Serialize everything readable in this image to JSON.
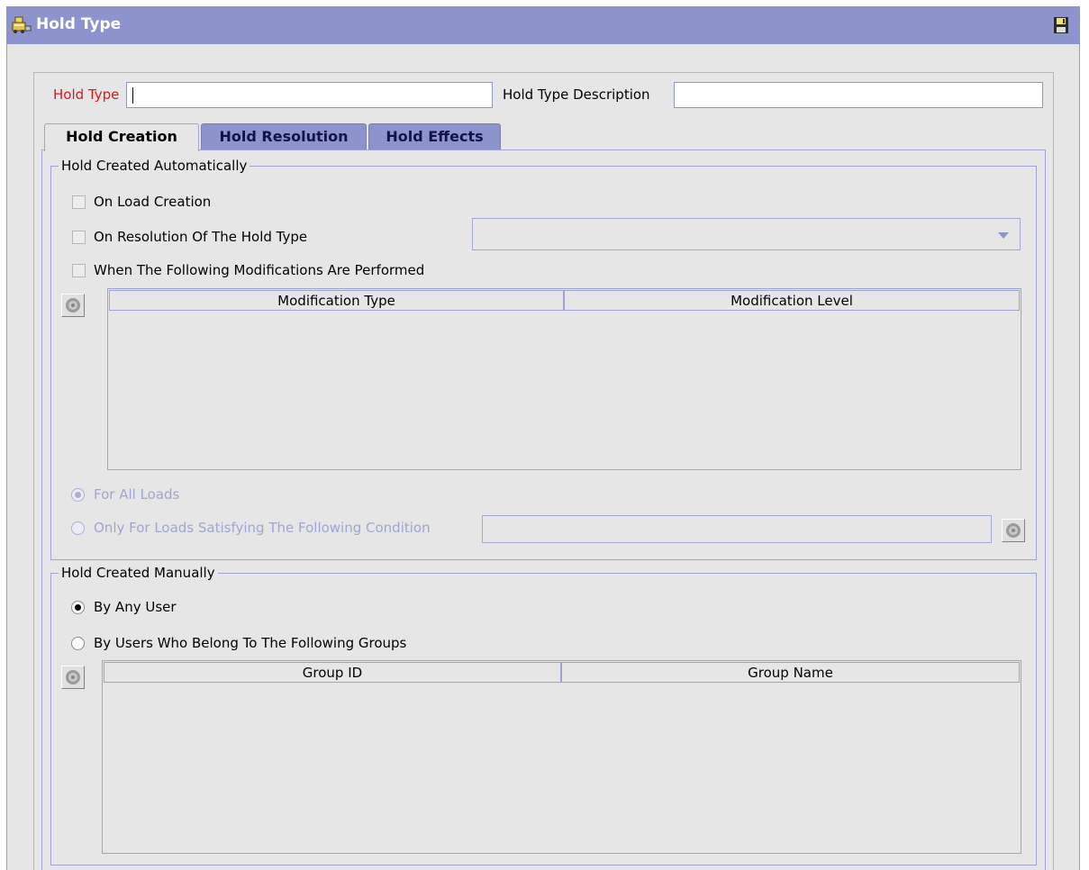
{
  "window": {
    "title": "Hold Type",
    "title_icon": "hold-type-icon",
    "save_icon": "save-icon"
  },
  "form": {
    "hold_type_label": "Hold Type",
    "hold_type_value": "",
    "hold_type_description_label": "Hold Type Description",
    "hold_type_description_value": ""
  },
  "tabs": [
    {
      "label": "Hold Creation",
      "active": true
    },
    {
      "label": "Hold Resolution",
      "active": false
    },
    {
      "label": "Hold Effects",
      "active": false
    }
  ],
  "auto": {
    "title": "Hold Created Automatically",
    "on_load_creation": "On Load Creation",
    "on_resolution": "On Resolution Of The Hold Type",
    "on_resolution_selected": "",
    "when_modifications": "When The Following Modifications Are Performed",
    "columns": [
      "Modification Type",
      "Modification Level"
    ],
    "for_all_loads": "For All Loads",
    "only_for_loads": "Only For Loads Satisfying The Following Condition",
    "condition_value": ""
  },
  "manual": {
    "title": "Hold Created Manually",
    "by_any_user": "By Any User",
    "by_users_in_groups": "By Users Who Belong To The Following Groups",
    "columns": [
      "Group ID",
      "Group Name"
    ]
  },
  "colors": {
    "title_bar": "#8d94cd",
    "required_label": "#e01818",
    "disabled_text": "#9fa6d2"
  }
}
